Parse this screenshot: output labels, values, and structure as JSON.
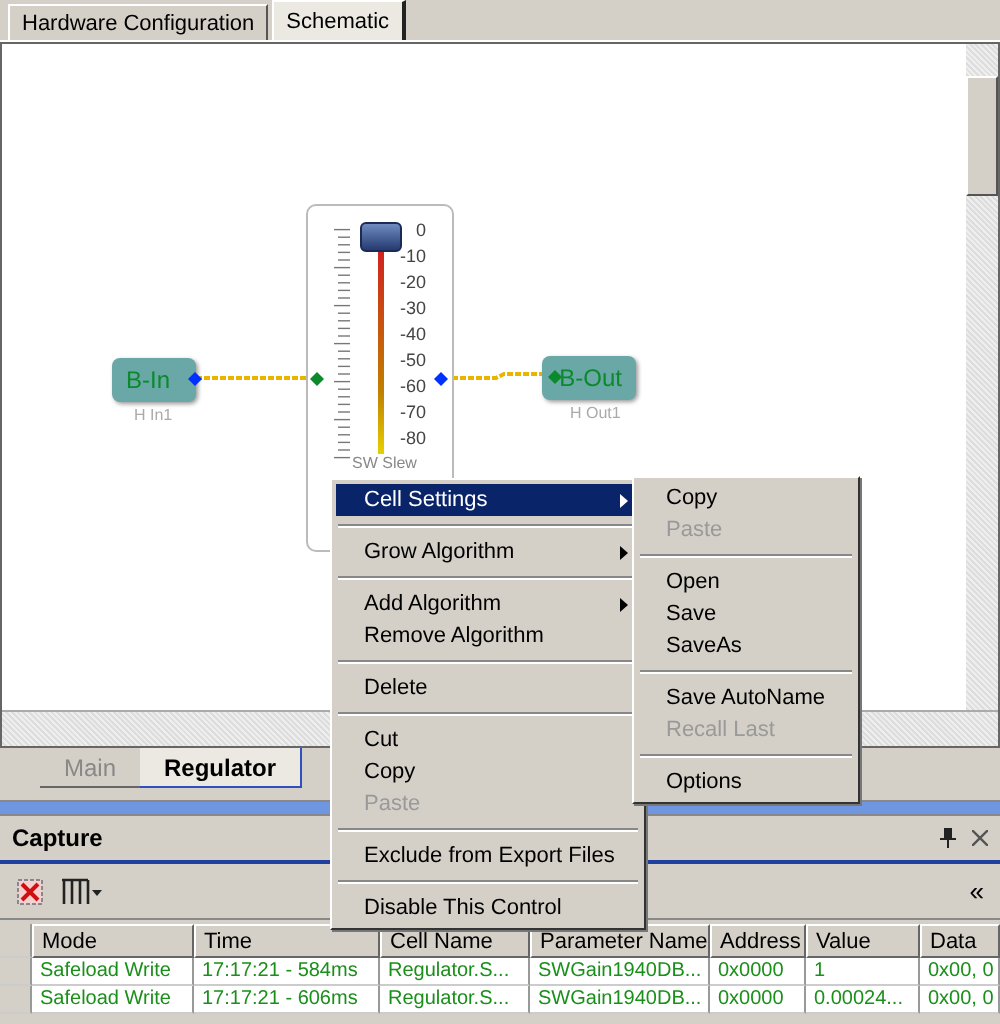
{
  "top_tabs": [
    {
      "label": "Hardware Configuration",
      "selected": false
    },
    {
      "label": "Schematic",
      "selected": true
    }
  ],
  "schematic": {
    "input_node": {
      "label": "B-In",
      "sublabel": "H In1"
    },
    "fader": {
      "label": "SW Slew",
      "level": 1,
      "scale": [
        "0",
        "-10",
        "-20",
        "-30",
        "-40",
        "-50",
        "-60",
        "-70",
        "-80"
      ]
    },
    "output_node": {
      "label": "B-Out",
      "sublabel": "H Out1"
    }
  },
  "context_menu": {
    "sections": [
      [
        {
          "label": "Cell Settings",
          "highlighted": true,
          "disabled": false,
          "submenu": true
        }
      ],
      [
        {
          "label": "Grow Algorithm",
          "highlighted": false,
          "disabled": false,
          "submenu": true
        }
      ],
      [
        {
          "label": "Add Algorithm",
          "highlighted": false,
          "disabled": false,
          "submenu": true
        },
        {
          "label": "Remove Algorithm",
          "highlighted": false,
          "disabled": false,
          "submenu": false
        }
      ],
      [
        {
          "label": "Delete",
          "highlighted": false,
          "disabled": false,
          "submenu": false
        }
      ],
      [
        {
          "label": "Cut",
          "highlighted": false,
          "disabled": false,
          "submenu": false
        },
        {
          "label": "Copy",
          "highlighted": false,
          "disabled": false,
          "submenu": false
        },
        {
          "label": "Paste",
          "highlighted": false,
          "disabled": true,
          "submenu": false
        }
      ],
      [
        {
          "label": "Exclude from Export Files",
          "highlighted": false,
          "disabled": false,
          "submenu": false
        }
      ],
      [
        {
          "label": "Disable This Control",
          "highlighted": false,
          "disabled": false,
          "submenu": false
        }
      ]
    ]
  },
  "submenu": {
    "sections": [
      [
        {
          "label": "Copy",
          "disabled": false
        },
        {
          "label": "Paste",
          "disabled": true
        }
      ],
      [
        {
          "label": "Open",
          "disabled": false
        },
        {
          "label": "Save",
          "disabled": false
        },
        {
          "label": "SaveAs",
          "disabled": false
        }
      ],
      [
        {
          "label": "Save AutoName",
          "disabled": false
        },
        {
          "label": "Recall Last",
          "disabled": true
        }
      ],
      [
        {
          "label": "Options",
          "disabled": false
        }
      ]
    ]
  },
  "sheet_tabs": [
    {
      "label": "Main",
      "selected": false
    },
    {
      "label": "Regulator",
      "selected": true
    }
  ],
  "capture": {
    "title": "Capture",
    "collapse": "«",
    "table": {
      "columns": [
        "Mode",
        "Time",
        "Cell Name",
        "Parameter Name",
        "Address",
        "Value",
        "Data"
      ],
      "rows": [
        [
          "Safeload Write",
          "17:17:21 - 584ms",
          "Regulator.S...",
          "SWGain1940DB...",
          "0x0000",
          "1",
          "0x00, 0"
        ],
        [
          "Safeload Write",
          "17:17:21 - 606ms",
          "Regulator.S...",
          "SWGain1940DB...",
          "0x0000",
          "0.00024...",
          "0x00, 0"
        ]
      ]
    }
  }
}
